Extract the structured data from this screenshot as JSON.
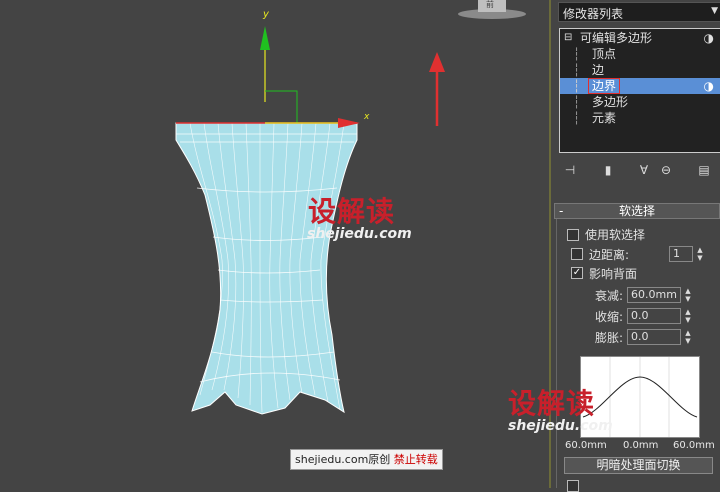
{
  "viewport": {
    "axis_y_label": "y",
    "axis_x_label": "x",
    "top_widget_label": "前"
  },
  "panel": {
    "modifier_list": "修改器列表",
    "stack": {
      "root": "可编辑多边形",
      "items": [
        "顶点",
        "边",
        "边界",
        "多边形",
        "元素"
      ],
      "selected_index": 2
    },
    "rollout": {
      "collapse": "-",
      "title": "软选择",
      "use_soft_select": "使用软选择",
      "edge_distance": "边距离:",
      "edge_distance_value": "1",
      "affect_backfacing": "影响背面",
      "falloff": "衰减:",
      "falloff_value": "60.0mm",
      "pinch": "收缩:",
      "pinch_value": "0.0",
      "bubble": "膨胀:",
      "bubble_value": "0.0",
      "curve_left": "60.0mm",
      "curve_mid": "0.0mm",
      "curve_right": "60.0mm",
      "shade_button": "明暗处理面切换",
      "use_soft_select_checked": false,
      "edge_distance_checked": false,
      "affect_backfacing_checked": true
    }
  },
  "watermarks": [
    {
      "cn": "设解读",
      "en": "shejiedu.com"
    },
    {
      "cn": "设解读",
      "en": "shejiedu.com"
    }
  ],
  "credit": {
    "site": "shejiedu.com原创",
    "warn": "禁止转载"
  },
  "colors": {
    "viewport_bg": "#444444",
    "mesh_fill": "#a9dfe9",
    "selection_blue": "#5a8fd6",
    "watermark_red": "#c8202b",
    "gizmo_red": "#e03030",
    "gizmo_green": "#20c020"
  }
}
